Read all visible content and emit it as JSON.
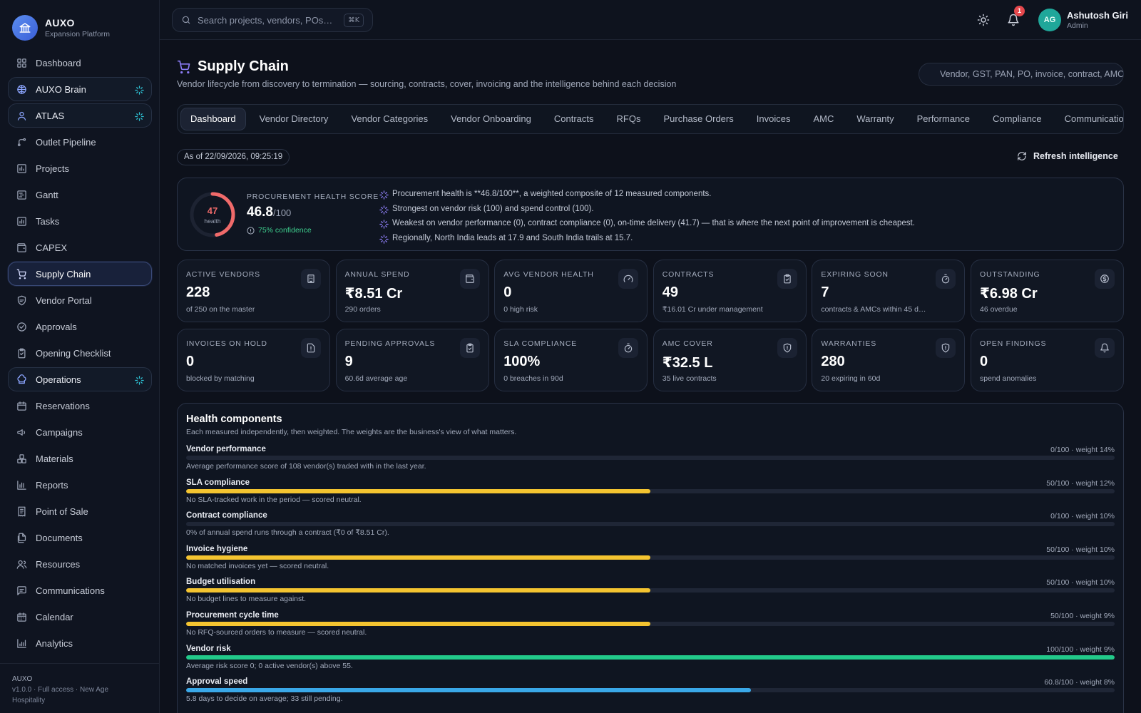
{
  "brand": {
    "name": "AUXO",
    "sub": "Expansion Platform"
  },
  "sidebar": {
    "items": [
      {
        "label": "Dashboard",
        "icon": "dashboard-icon",
        "state": "normal"
      },
      {
        "label": "AUXO Brain",
        "icon": "brain-icon",
        "state": "boxed",
        "spark": true
      },
      {
        "label": "ATLAS",
        "icon": "user-icon",
        "state": "boxed",
        "spark": true
      },
      {
        "label": "Outlet Pipeline",
        "icon": "pipeline-icon",
        "state": "normal"
      },
      {
        "label": "Projects",
        "icon": "projects-icon",
        "state": "normal"
      },
      {
        "label": "Gantt",
        "icon": "gantt-icon",
        "state": "normal"
      },
      {
        "label": "Tasks",
        "icon": "tasks-icon",
        "state": "normal"
      },
      {
        "label": "CAPEX",
        "icon": "wallet-icon",
        "state": "normal"
      },
      {
        "label": "Supply Chain",
        "icon": "cart-icon",
        "state": "active"
      },
      {
        "label": "Vendor Portal",
        "icon": "shield-icon",
        "state": "normal"
      },
      {
        "label": "Approvals",
        "icon": "check-circle-icon",
        "state": "normal"
      },
      {
        "label": "Opening Checklist",
        "icon": "clipboard-icon",
        "state": "normal"
      },
      {
        "label": "Operations",
        "icon": "chef-hat-icon",
        "state": "boxed",
        "spark": true
      },
      {
        "label": "Reservations",
        "icon": "calendar-icon",
        "state": "normal"
      },
      {
        "label": "Campaigns",
        "icon": "megaphone-icon",
        "state": "normal"
      },
      {
        "label": "Materials",
        "icon": "boxes-icon",
        "state": "normal"
      },
      {
        "label": "Reports",
        "icon": "bar-chart-icon",
        "state": "normal"
      },
      {
        "label": "Point of Sale",
        "icon": "receipt-icon",
        "state": "normal"
      },
      {
        "label": "Documents",
        "icon": "documents-icon",
        "state": "normal"
      },
      {
        "label": "Resources",
        "icon": "users-icon",
        "state": "normal"
      },
      {
        "label": "Communications",
        "icon": "chat-icon",
        "state": "normal"
      },
      {
        "label": "Calendar",
        "icon": "calendar-days-icon",
        "state": "normal"
      },
      {
        "label": "Analytics",
        "icon": "analytics-icon",
        "state": "normal"
      }
    ],
    "footer": {
      "app": "AUXO",
      "line1": "v1.0.0 · Full access · New Age",
      "line2": "Hospitality"
    }
  },
  "topbar": {
    "search_placeholder": "Search projects, vendors, POs…",
    "shortcut": "⌘K",
    "notifications": "1",
    "user": {
      "initials": "AG",
      "name": "Ashutosh Giri",
      "role": "Admin"
    }
  },
  "page": {
    "title": "Supply Chain",
    "subtitle": "Vendor lifecycle from discovery to termination — sourcing, contracts, cover, invoicing and the intelligence behind each decision",
    "search_placeholder": "Vendor, GST, PAN, PO, invoice, contract, AMC"
  },
  "tabs": [
    "Dashboard",
    "Vendor Directory",
    "Vendor Categories",
    "Vendor Onboarding",
    "Contracts",
    "RFQs",
    "Purchase Orders",
    "Invoices",
    "AMC",
    "Warranty",
    "Performance",
    "Compliance",
    "Communications"
  ],
  "active_tab": "Dashboard",
  "asof": "As of 22/09/2026, 09:25:19",
  "refresh_label": "Refresh intelligence",
  "health": {
    "gauge_value": "47",
    "gauge_label": "health",
    "gauge_fraction": 0.468,
    "gauge_color": "#f06a6a",
    "label": "PROCUREMENT HEALTH SCORE",
    "score": "46.8",
    "denominator": "/100",
    "confidence": "75% confidence",
    "insights": [
      "Procurement health is **46.8/100**, a weighted composite of 12 measured components.",
      "Strongest on vendor risk (100) and spend control (100).",
      "Weakest on vendor performance (0), contract compliance (0), on-time delivery (41.7) — that is where the next point of improvement is cheapest.",
      "Regionally, North India leads at 17.9 and South India trails at 15.7."
    ]
  },
  "cards": [
    {
      "label": "ACTIVE VENDORS",
      "value": "228",
      "sub": "of 250 on the master",
      "icon": "building-icon"
    },
    {
      "label": "ANNUAL SPEND",
      "value": "₹8.51 Cr",
      "sub": "290 orders",
      "icon": "wallet-icon"
    },
    {
      "label": "AVG VENDOR HEALTH",
      "value": "0",
      "sub": "0 high risk",
      "icon": "gauge-icon"
    },
    {
      "label": "CONTRACTS",
      "value": "49",
      "sub": "₹16.01 Cr under management",
      "icon": "clipboard-check-icon"
    },
    {
      "label": "EXPIRING SOON",
      "value": "7",
      "sub": "contracts & AMCs within 45 d…",
      "icon": "timer-icon"
    },
    {
      "label": "OUTSTANDING",
      "value": "₹6.98 Cr",
      "sub": "46 overdue",
      "icon": "currency-icon"
    },
    {
      "label": "INVOICES ON HOLD",
      "value": "0",
      "sub": "blocked by matching",
      "icon": "file-alert-icon"
    },
    {
      "label": "PENDING APPROVALS",
      "value": "9",
      "sub": "60.6d average age",
      "icon": "clipboard-check-icon"
    },
    {
      "label": "SLA COMPLIANCE",
      "value": "100%",
      "sub": "0 breaches in 90d",
      "icon": "timer-icon"
    },
    {
      "label": "AMC COVER",
      "value": "₹32.5 L",
      "sub": "35 live contracts",
      "icon": "shield-check-icon"
    },
    {
      "label": "WARRANTIES",
      "value": "280",
      "sub": "20 expiring in 60d",
      "icon": "shield-check-icon"
    },
    {
      "label": "OPEN FINDINGS",
      "value": "0",
      "sub": "spend anomalies",
      "icon": "bell-icon"
    }
  ],
  "components": {
    "title": "Health components",
    "subtitle": "Each measured independently, then weighted. The weights are the business's view of what matters.",
    "items": [
      {
        "name": "Vendor performance",
        "score": 0,
        "meta": "0/100 · weight 14%",
        "desc": "Average performance score of 108 vendor(s) traded with in the last year.",
        "color": "#f4c430"
      },
      {
        "name": "SLA compliance",
        "score": 50,
        "meta": "50/100 · weight 12%",
        "desc": "No SLA-tracked work in the period — scored neutral.",
        "color": "#f4c430"
      },
      {
        "name": "Contract compliance",
        "score": 0,
        "meta": "0/100 · weight 10%",
        "desc": "0% of annual spend runs through a contract (₹0 of ₹8.51 Cr).",
        "color": "#f4c430"
      },
      {
        "name": "Invoice hygiene",
        "score": 50,
        "meta": "50/100 · weight 10%",
        "desc": "No matched invoices yet — scored neutral.",
        "color": "#f4c430"
      },
      {
        "name": "Budget utilisation",
        "score": 50,
        "meta": "50/100 · weight 10%",
        "desc": "No budget lines to measure against.",
        "color": "#f4c430"
      },
      {
        "name": "Procurement cycle time",
        "score": 50,
        "meta": "50/100 · weight 9%",
        "desc": "No RFQ-sourced orders to measure — scored neutral.",
        "color": "#f4c430"
      },
      {
        "name": "Vendor risk",
        "score": 100,
        "meta": "100/100 · weight 9%",
        "desc": "Average risk score 0; 0 active vendor(s) above 55.",
        "color": "#22c98a"
      },
      {
        "name": "Approval speed",
        "score": 60.8,
        "meta": "60.8/100 · weight 8%",
        "desc": "5.8 days to decide on average; 33 still pending.",
        "color": "#3aa8e8"
      }
    ]
  }
}
